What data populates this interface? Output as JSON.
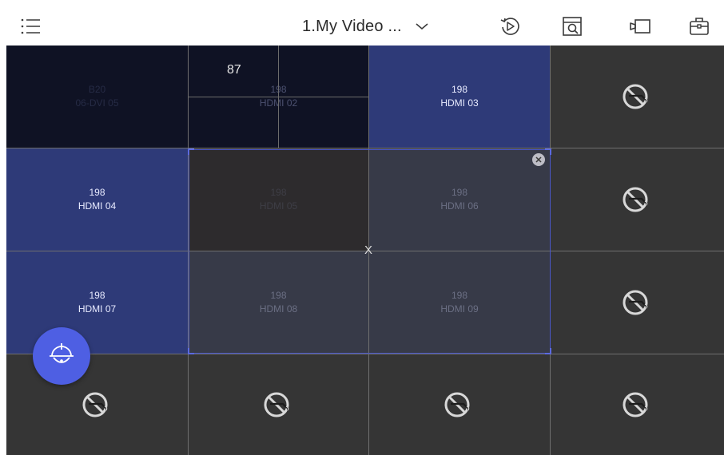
{
  "header": {
    "title": "1.My Video ...",
    "icons": [
      "menu-list-icon",
      "chevron-down-icon",
      "replay-icon",
      "window-search-icon",
      "camera-icon",
      "toolbox-icon"
    ]
  },
  "wall": {
    "rows": 4,
    "cols": 4,
    "cells": [
      {
        "row": 1,
        "col": 1,
        "id": "B20",
        "source": "06-DVI 05",
        "state": "dim"
      },
      {
        "row": 1,
        "col": 2,
        "id": "198",
        "source": "HDMI 02",
        "state": "split",
        "window_number": "87"
      },
      {
        "row": 1,
        "col": 3,
        "id": "198",
        "source": "HDMI 03",
        "state": "active"
      },
      {
        "row": 1,
        "col": 4,
        "id": "",
        "source": "",
        "state": "no-signal"
      },
      {
        "row": 2,
        "col": 1,
        "id": "198",
        "source": "HDMI 04",
        "state": "active"
      },
      {
        "row": 2,
        "col": 2,
        "id": "198",
        "source": "HDMI 05",
        "state": "selected-dark"
      },
      {
        "row": 2,
        "col": 3,
        "id": "198",
        "source": "HDMI 06",
        "state": "selected"
      },
      {
        "row": 2,
        "col": 4,
        "id": "",
        "source": "",
        "state": "no-signal"
      },
      {
        "row": 3,
        "col": 1,
        "id": "198",
        "source": "HDMI 07",
        "state": "active"
      },
      {
        "row": 3,
        "col": 2,
        "id": "198",
        "source": "HDMI 08",
        "state": "selected"
      },
      {
        "row": 3,
        "col": 3,
        "id": "198",
        "source": "HDMI 09",
        "state": "selected"
      },
      {
        "row": 3,
        "col": 4,
        "id": "",
        "source": "",
        "state": "no-signal"
      },
      {
        "row": 4,
        "col": 1,
        "id": "",
        "source": "",
        "state": "no-signal"
      },
      {
        "row": 4,
        "col": 2,
        "id": "",
        "source": "",
        "state": "no-signal"
      },
      {
        "row": 4,
        "col": 3,
        "id": "",
        "source": "",
        "state": "no-signal"
      },
      {
        "row": 4,
        "col": 4,
        "id": "",
        "source": "",
        "state": "no-signal"
      }
    ],
    "merge_marker": "X"
  },
  "colors": {
    "accent": "#4e5fe3",
    "active_cell": "#2e3a78",
    "dark_cell": "#0f1224",
    "empty_cell": "#353535",
    "selection_border": "#4a57c8"
  },
  "fab": {
    "icon": "dome-camera-icon"
  }
}
